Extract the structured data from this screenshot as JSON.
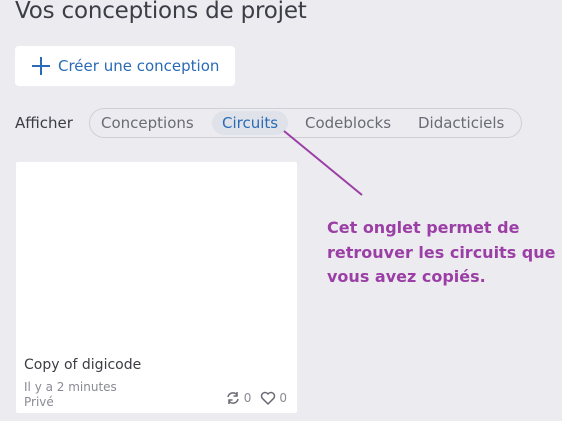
{
  "header": {
    "title": "Vos conceptions de projet"
  },
  "create_button": {
    "label": "Créer une conception"
  },
  "filter": {
    "label": "Afficher",
    "tabs": [
      {
        "label": "Conceptions",
        "active": false
      },
      {
        "label": "Circuits",
        "active": true
      },
      {
        "label": "Codeblocks",
        "active": false
      },
      {
        "label": "Didacticiels",
        "active": false
      }
    ]
  },
  "card": {
    "title": "Copy of digicode",
    "time": "Il y a 2 minutes",
    "privacy": "Privé",
    "copies": "0",
    "likes": "0"
  },
  "annotation": {
    "lines": [
      "Cet onglet permet de",
      "retrouver les circuits que",
      "vous avez copiés."
    ],
    "color": "#9b3fa6"
  },
  "colors": {
    "accent": "#2a6bb5",
    "background": "#ececf0",
    "annotation": "#9b3fa6"
  }
}
